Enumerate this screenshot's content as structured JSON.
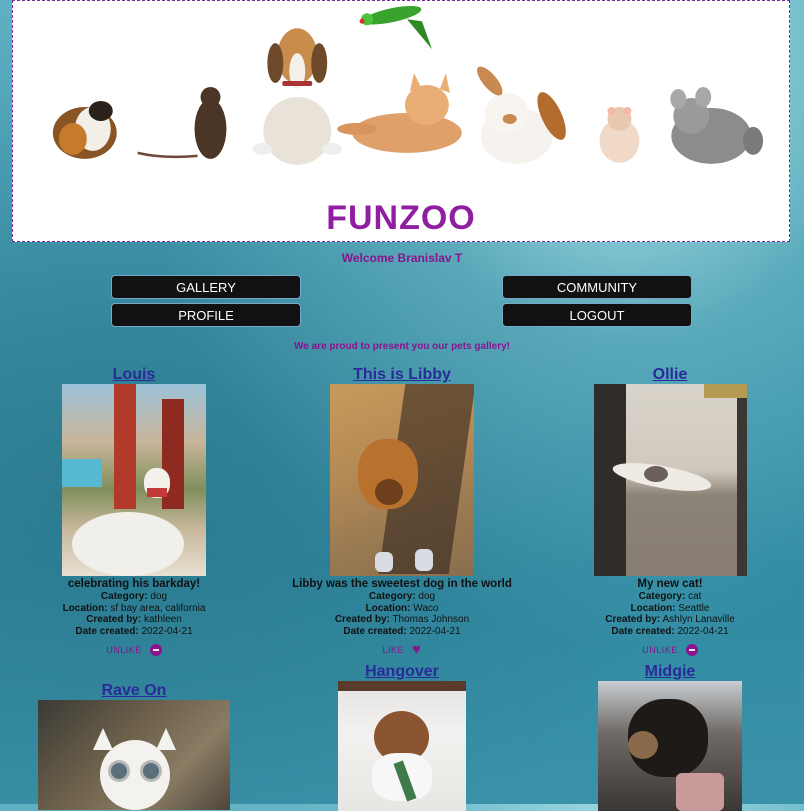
{
  "header": {
    "logo": "FUNZOO"
  },
  "welcome": "Welcome Branislav T",
  "nav": {
    "gallery": "GALLERY",
    "community": "COMMUNITY",
    "profile": "PROFILE",
    "logout": "LOGOUT"
  },
  "tagline": "We are proud to present you our pets gallery!",
  "labels": {
    "category": "Category:",
    "location": "Location:",
    "created_by": "Created by:",
    "date_created": "Date created:"
  },
  "pets": [
    {
      "name": "Louis",
      "description": "celebrating his barkday!",
      "category": "dog",
      "location": "sf bay area, california",
      "created_by": "kathleen",
      "date_created": "2022-04-21",
      "action": "UNLIKE"
    },
    {
      "name": "This is Libby",
      "description": "Libby was the sweetest dog in the world",
      "category": "dog",
      "location": "Waco",
      "created_by": "Thomas Johnson",
      "date_created": "2022-04-21",
      "action": "LIKE"
    },
    {
      "name": "Ollie",
      "description": "My new cat!",
      "category": "cat",
      "location": "Seattle",
      "created_by": "Ashlyn Lanaville",
      "date_created": "2022-04-21",
      "action": "UNLIKE"
    },
    {
      "name": "Rave On"
    },
    {
      "name": "Hangover"
    },
    {
      "name": "Midgie"
    }
  ],
  "colors": {
    "accent": "#8a138f",
    "link": "#2b2a9a",
    "button": "#111111"
  }
}
